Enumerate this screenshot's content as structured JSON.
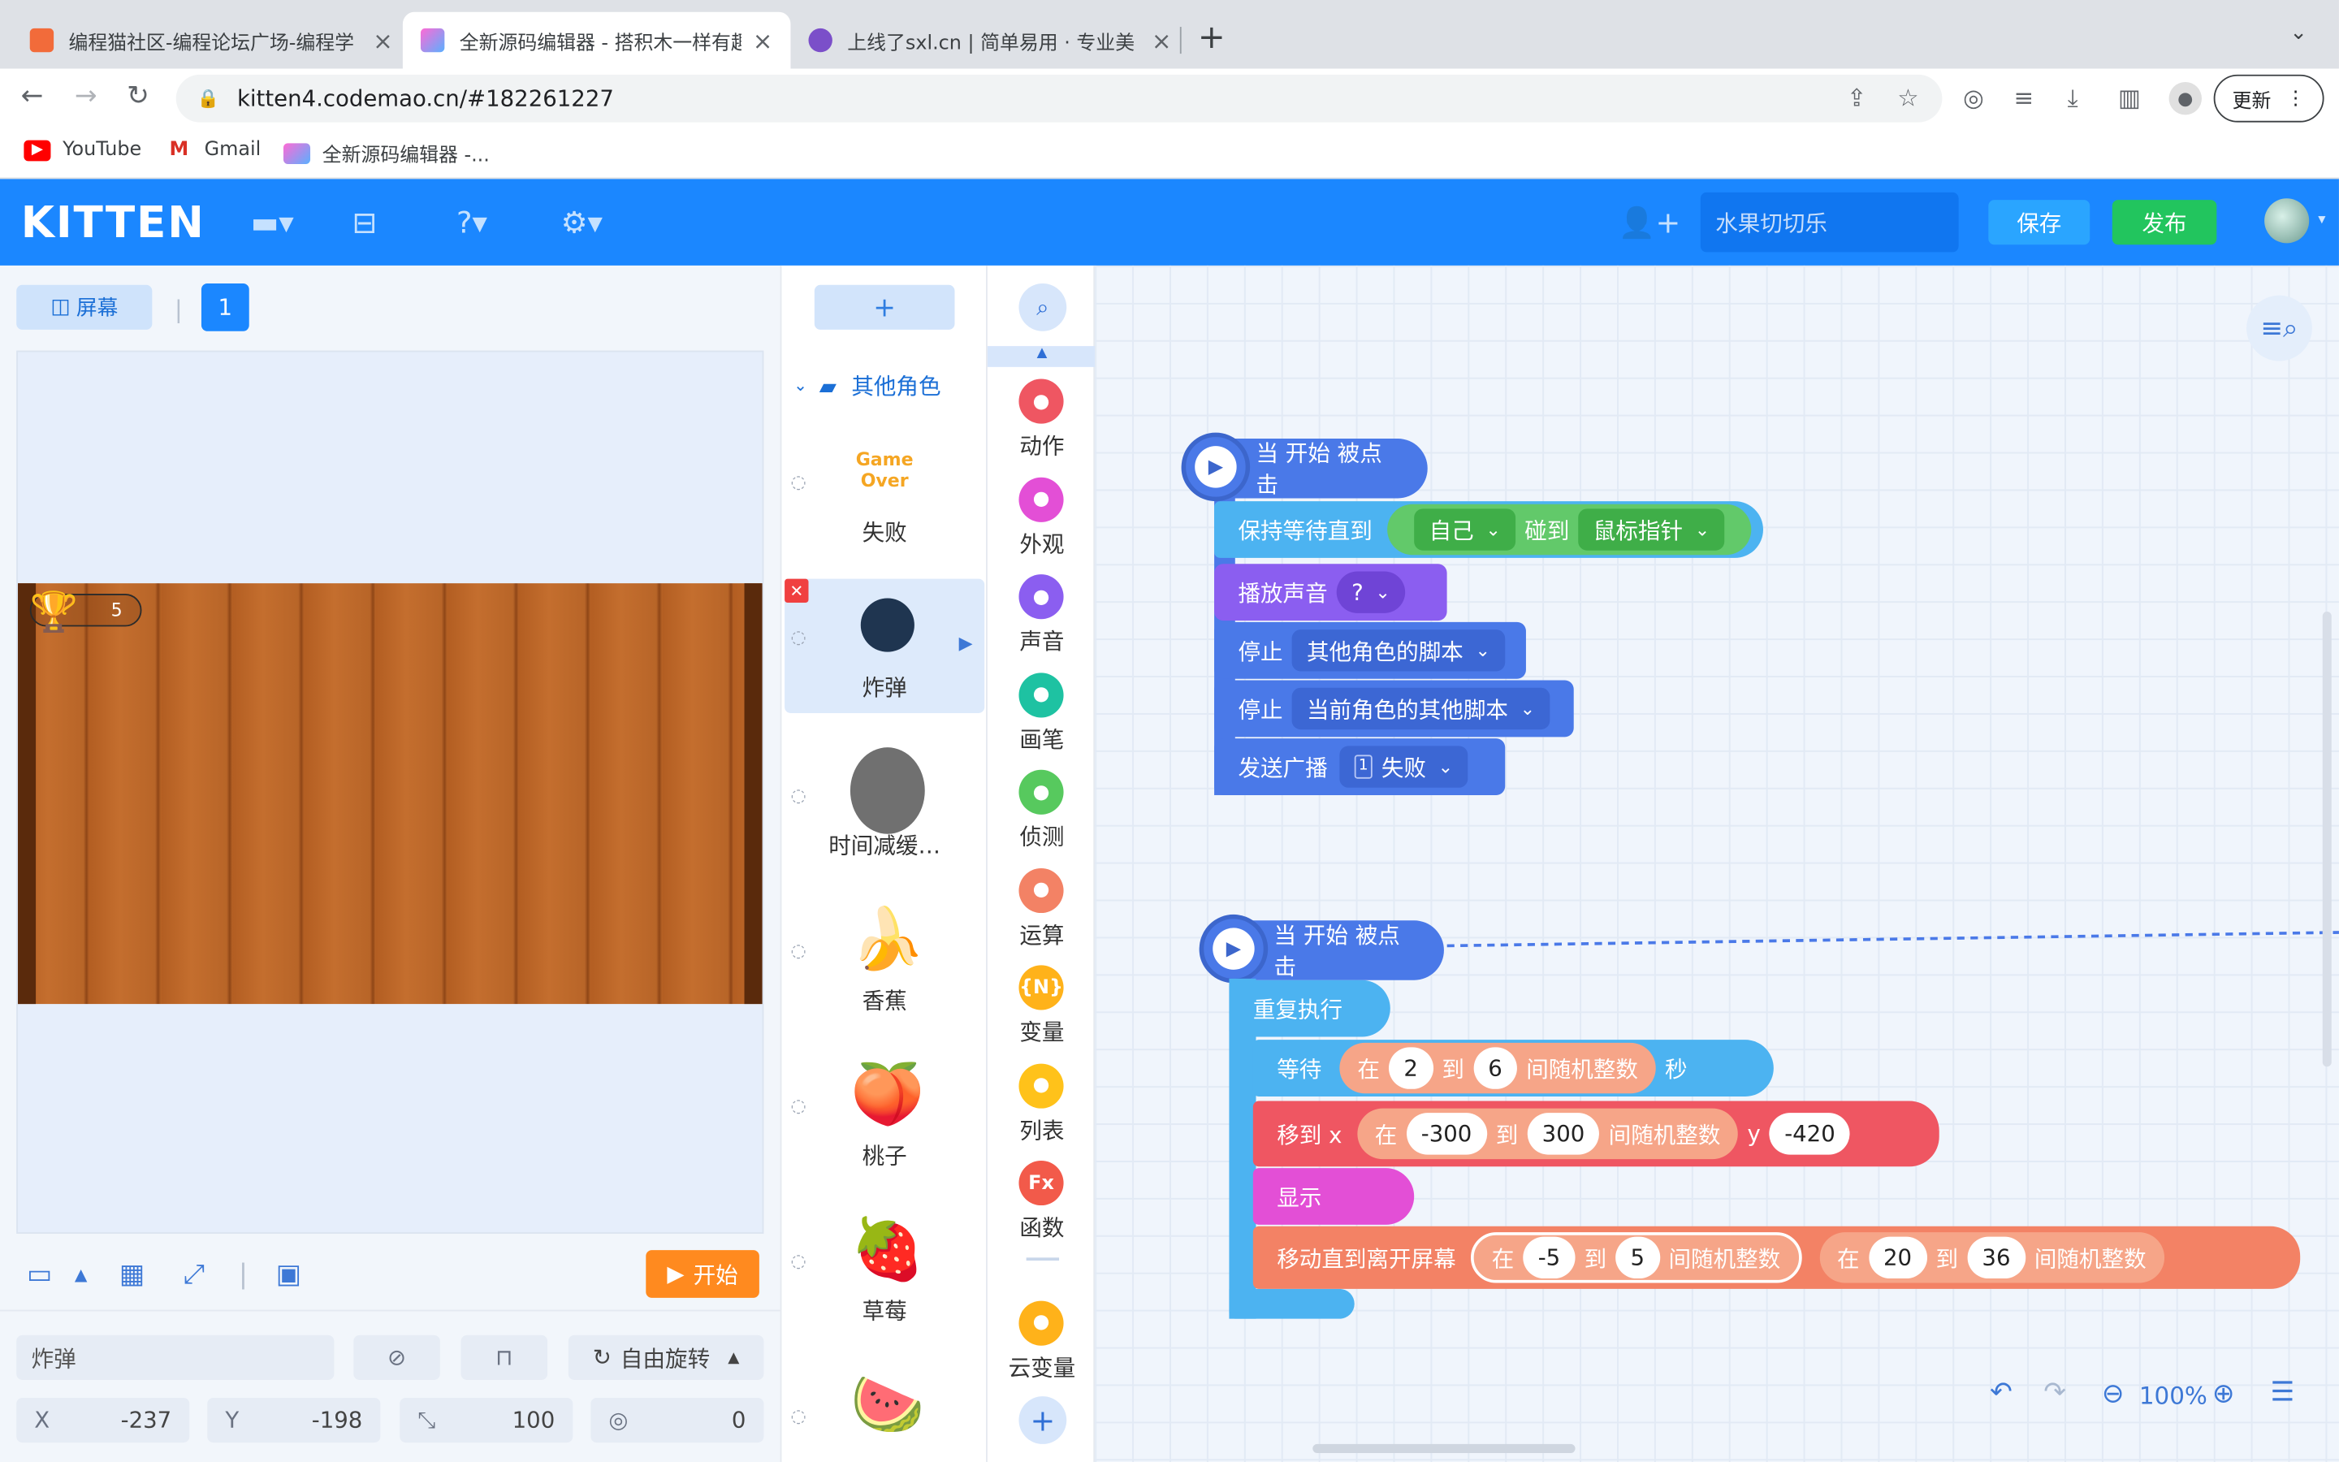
{
  "browser": {
    "tabs": [
      {
        "title": "编程猫社区-编程论坛广场-编程学"
      },
      {
        "title": "全新源码编辑器 - 搭积木一样有趣"
      },
      {
        "title": "上线了sxl.cn | 简单易用 · 专业美"
      }
    ],
    "url": "kitten4.codemao.cn/#182261227",
    "update_label": "更新",
    "bookmarks": [
      "YouTube",
      "Gmail",
      "全新源码编辑器 -..."
    ]
  },
  "header": {
    "logo": "KITTEN",
    "project_name": "水果切切乐",
    "save_label": "保存",
    "publish_label": "发布"
  },
  "stage": {
    "screen_label": "屏幕",
    "page_number": "1",
    "score": "5",
    "start_label": "开始"
  },
  "properties": {
    "sprite_name": "炸弹",
    "rotation_label": "自由旋转",
    "x_label": "X",
    "x_value": "-237",
    "y_label": "Y",
    "y_value": "-198",
    "size_value": "100",
    "direction_value": "0"
  },
  "sprites": {
    "add_label": "+",
    "folder_label": "其他角色",
    "items": [
      {
        "name": "失败",
        "thumb_text": "Game Over"
      },
      {
        "name": "炸弹"
      },
      {
        "name": "时间减缓…"
      },
      {
        "name": "香蕉"
      },
      {
        "name": "桃子"
      },
      {
        "name": "草莓"
      }
    ]
  },
  "categories": [
    {
      "name": "动作",
      "color": "#ef5662"
    },
    {
      "name": "外观",
      "color": "#e34fd6"
    },
    {
      "name": "声音",
      "color": "#8b5ef0"
    },
    {
      "name": "画笔",
      "color": "#1ec2a2"
    },
    {
      "name": "侦测",
      "color": "#57c95e"
    },
    {
      "name": "运算",
      "color": "#f38265"
    },
    {
      "name": "变量",
      "color": "#ffb21a",
      "glyph": "{N}"
    },
    {
      "name": "列表",
      "color": "#ffc21a"
    },
    {
      "name": "函数",
      "color": "#f25a4a",
      "glyph": "Fx"
    },
    {
      "name": "云变量",
      "color": "#ffb21a"
    }
  ],
  "script1": {
    "hat": "当 开始 被点击",
    "wait_until": "保持等待直到",
    "self": "自己",
    "touch": "碰到",
    "mouse": "鼠标指针",
    "play_sound": "播放声音",
    "sound_value": "?",
    "stop1": "停止",
    "stop1_value": "其他角色的脚本",
    "stop2": "停止",
    "stop2_value": "当前角色的其他脚本",
    "broadcast": "发送广播",
    "broadcast_value": "失败"
  },
  "script2": {
    "hat": "当 开始 被点击",
    "repeat": "重复执行",
    "wait": "等待",
    "in": "在",
    "to": "到",
    "random": "间随机整数",
    "sec": "秒",
    "wait_from": "2",
    "wait_to": "6",
    "moveto": "移到 x",
    "x_from": "-300",
    "x_to": "300",
    "y_label": "y",
    "y_value": "-420",
    "show": "显示",
    "move_until": "移动直到离开屏幕",
    "a_from": "-5",
    "a_to": "5",
    "b_from": "20",
    "b_to": "36"
  },
  "zoom": "100%"
}
